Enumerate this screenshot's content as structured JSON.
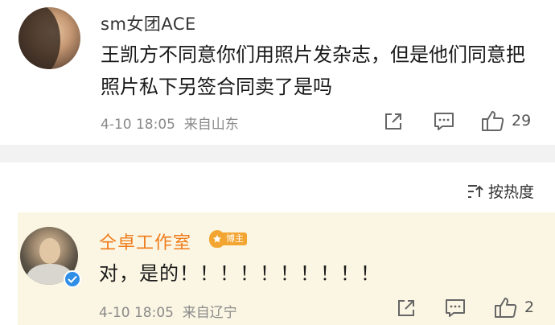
{
  "comments": [
    {
      "username": "sm女团ACE",
      "text": "王凯方不同意你们用照片发杂志，但是他们同意把照片私下另签合同卖了是吗",
      "date": "4-10 18:05",
      "location": "来自山东",
      "likes": "29"
    },
    {
      "username": "仝卓工作室",
      "badge_label": "博主",
      "text": "对，是的！！！！！！！！！！",
      "date": "4-10 18:05",
      "location": "来自辽宁",
      "likes": "2"
    }
  ],
  "sort": {
    "label": "按热度"
  },
  "icons": {
    "share": "share-icon",
    "comment": "comment-icon",
    "like": "thumbs-up-icon",
    "sort": "sort-icon",
    "verified": "verified-icon"
  },
  "colors": {
    "highlight_bg": "#fbf6e3",
    "reply_username": "#ef7b1a",
    "badge": "#f3a532",
    "verified": "#2f8ee6",
    "meta_text": "#8a8a8a"
  }
}
